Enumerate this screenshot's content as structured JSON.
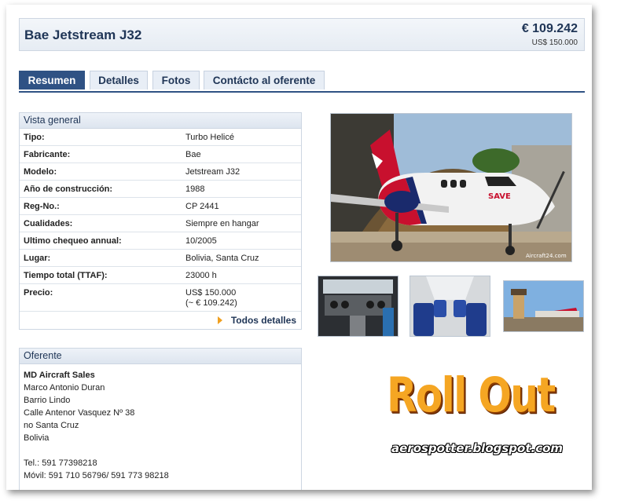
{
  "listing": {
    "title": "Bae Jetstream J32",
    "price_eur": "€ 109.242",
    "price_usd": "US$ 150.000"
  },
  "tabs": [
    {
      "label": "Resumen",
      "active": true
    },
    {
      "label": "Detalles",
      "active": false
    },
    {
      "label": "Fotos",
      "active": false
    },
    {
      "label": "Contácto al oferente",
      "active": false
    }
  ],
  "overview": {
    "heading": "Vista general",
    "rows": [
      {
        "key": "Tipo:",
        "value": "Turbo Helicé"
      },
      {
        "key": "Fabricante:",
        "value": "Bae"
      },
      {
        "key": "Modelo:",
        "value": "Jetstream J32"
      },
      {
        "key": "Año de construcción:",
        "value": "1988"
      },
      {
        "key": "Reg-No.:",
        "value": "CP 2441"
      },
      {
        "key": "Cualidades:",
        "value": "Siempre en hangar"
      },
      {
        "key": "Ultimo chequeo annual:",
        "value": "10/2005"
      },
      {
        "key": "Lugar:",
        "value": "Bolivia, Santa Cruz"
      },
      {
        "key": "Tiempo total (TTAF):",
        "value": "23000 h"
      }
    ],
    "price_row": {
      "key": "Precio:",
      "value": "US$ 150.000",
      "value2": "(~ € 109.242)"
    },
    "all_details_label": "Todos detalles"
  },
  "seller": {
    "heading": "Oferente",
    "company": "MD Aircraft Sales",
    "lines": [
      "Marco Antonio Duran",
      "Barrio Lindo",
      "Calle Antenor Vasquez Nº 38",
      "no Santa Cruz",
      "Bolivia"
    ],
    "phone": "Tel.: 591 77398218",
    "mobile": "Móvil: 591 710 56796/ 591 773 98218"
  },
  "photos": {
    "watermark": "Aircraft24.com",
    "livery_text": "SAVE"
  },
  "overlay": {
    "logo_text": "Roll Out",
    "blog": "aerospotter.blogspot.com"
  },
  "colors": {
    "brand": "#2f5284",
    "title": "#1f3556",
    "accent": "#f0a020"
  }
}
